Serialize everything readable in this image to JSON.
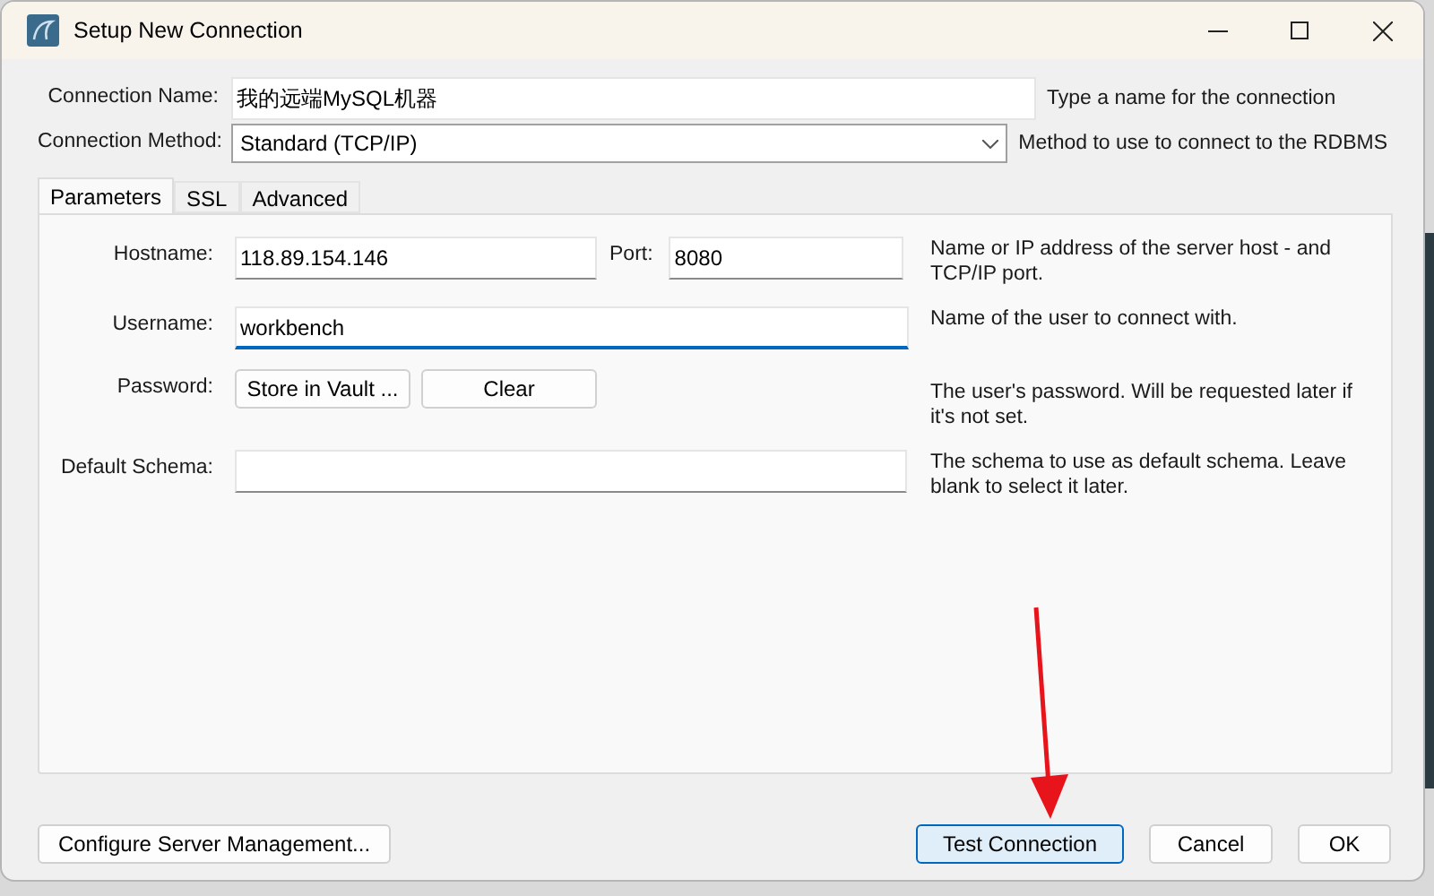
{
  "window": {
    "title": "Setup New Connection"
  },
  "connection_name": {
    "label": "Connection Name:",
    "value": "我的远端MySQL机器",
    "help": "Type a name for the connection"
  },
  "connection_method": {
    "label": "Connection Method:",
    "value": "Standard (TCP/IP)",
    "help": "Method to use to connect to the RDBMS"
  },
  "tabs": [
    {
      "label": "Parameters",
      "selected": true
    },
    {
      "label": "SSL",
      "selected": false
    },
    {
      "label": "Advanced",
      "selected": false
    }
  ],
  "parameters": {
    "hostname": {
      "label": "Hostname:",
      "value": "118.89.154.146"
    },
    "port": {
      "label": "Port:",
      "value": "8080"
    },
    "host_help": "Name or IP address of the server host - and TCP/IP port.",
    "username": {
      "label": "Username:",
      "value": "workbench",
      "focused": true,
      "help": "Name of the user to connect with."
    },
    "password": {
      "label": "Password:",
      "buttons": [
        "Store in Vault ...",
        "Clear"
      ],
      "help": "The user's password. Will be requested later if it's not set."
    },
    "default_schema": {
      "label": "Default Schema:",
      "help": "The schema to use as default schema. Leave blank to select it later."
    }
  },
  "footer": {
    "left_button": "Configure Server Management...",
    "buttons": [
      {
        "label": "Test Connection",
        "selected": true
      },
      {
        "label": "Cancel",
        "selected": false
      },
      {
        "label": "OK",
        "selected": false
      }
    ]
  }
}
